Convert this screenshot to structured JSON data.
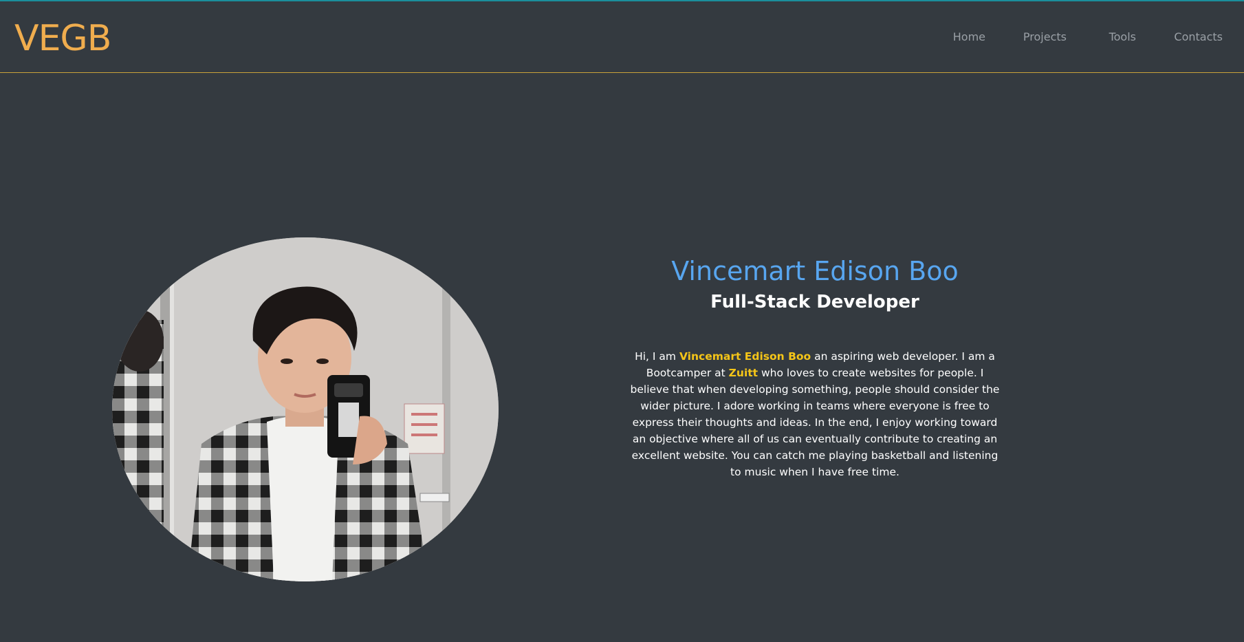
{
  "header": {
    "brand": "VEGB",
    "nav": [
      {
        "label": "Home"
      },
      {
        "label": "Projects"
      },
      {
        "label": "Tools"
      },
      {
        "label": "Contacts"
      }
    ]
  },
  "hero": {
    "name": "Vincemart Edison Boo",
    "role": "Full-Stack Developer",
    "bio": {
      "pre": "Hi, I am ",
      "name_highlight": "Vincemart Edison Boo",
      "mid1": " an aspiring web developer. I am a Bootcamper at ",
      "org_highlight": "Zuitt",
      "rest": " who loves to create websites for people. I believe that when developing something, people should consider the wider picture. I adore working in teams where everyone is free to express their thoughts and ideas. In the end, I enjoy working toward an objective where all of us can eventually contribute to creating an excellent website. You can catch me playing basketball and listening to music when I have free time."
    }
  },
  "colors": {
    "background": "#343a40",
    "brand": "#f0ad4e",
    "name": "#58a6f0",
    "highlight": "#f5c518",
    "header_border": "#c9a33a"
  }
}
